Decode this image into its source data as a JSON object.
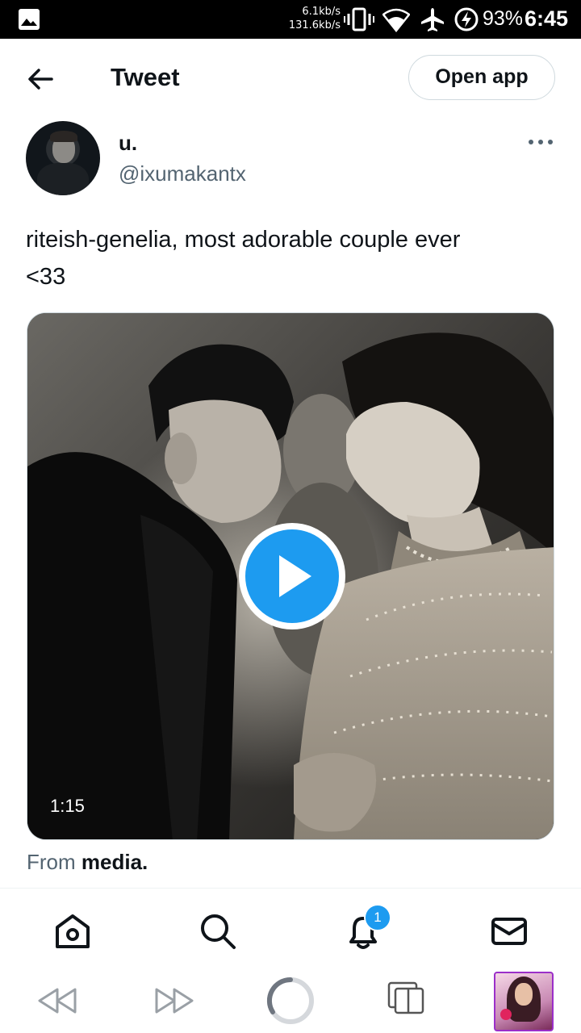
{
  "status_bar": {
    "download_speed": "6.1kb/s",
    "upload_speed": "131.6kb/s",
    "battery": "93%",
    "time": "6:45",
    "icons": [
      "gallery-icon",
      "vibrate-icon",
      "wifi-icon",
      "airplane-mode-icon",
      "battery-saver-icon"
    ]
  },
  "header": {
    "title": "Tweet",
    "open_app_label": "Open app"
  },
  "author": {
    "display_name": "u.",
    "username": "@ixumakantx"
  },
  "tweet": {
    "text": "riteish-genelia, most adorable couple ever\n<33",
    "media": {
      "type": "video",
      "duration": "1:15"
    },
    "attribution_prefix": "From",
    "attribution_source": "media."
  },
  "bottom_nav": {
    "items": [
      "home-icon",
      "search-icon",
      "notifications-icon",
      "messages-icon"
    ],
    "notification_count": "1"
  },
  "browser_bar": {
    "items": [
      "back-icon",
      "forward-icon",
      "reload-icon",
      "tabs-icon"
    ]
  },
  "colors": {
    "accent": "#1d9bf0",
    "text_primary": "#0f1419",
    "text_secondary": "#536471",
    "border": "#cfd9de",
    "thumb_border": "#9b2fc9"
  }
}
